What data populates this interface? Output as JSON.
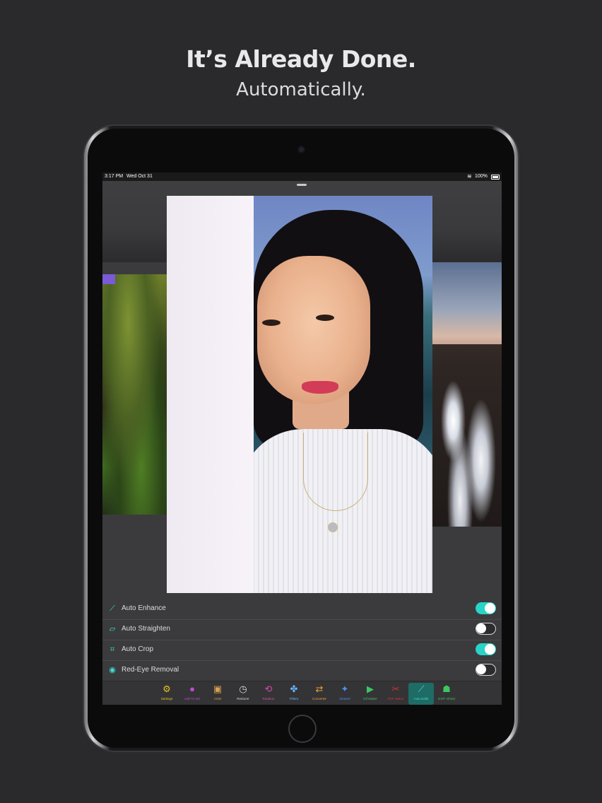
{
  "marketing": {
    "headline": "It’s Already Done.",
    "subline": "Automatically."
  },
  "status_bar": {
    "time": "3:17 PM",
    "date": "Wed Oct 31",
    "battery": "100%"
  },
  "options": [
    {
      "label": "Auto Enhance",
      "icon": "magic-wand-icon",
      "glyph": "⟋",
      "enabled": true
    },
    {
      "label": "Auto Straighten",
      "icon": "straighten-icon",
      "glyph": "▱",
      "enabled": false
    },
    {
      "label": "Auto Crop",
      "icon": "crop-icon",
      "glyph": "⌗",
      "enabled": true
    },
    {
      "label": "Red-Eye Removal",
      "icon": "eye-icon",
      "glyph": "◉",
      "enabled": false
    }
  ],
  "toolbar": [
    {
      "label": "Settings",
      "icon": "gear-icon",
      "glyph": "⚙",
      "color": "#e8c21a"
    },
    {
      "label": "Add To Siri",
      "icon": "siri-icon",
      "glyph": "●",
      "color": "#c04cd8"
    },
    {
      "label": "Artist",
      "icon": "artist-icon",
      "glyph": "▣",
      "color": "#d9a04a"
    },
    {
      "label": "Restorer",
      "icon": "clock-icon",
      "glyph": "◷",
      "color": "#d9d9db"
    },
    {
      "label": "Rotation",
      "icon": "rotate-icon",
      "glyph": "⟲",
      "color": "#d84bb0"
    },
    {
      "label": "Filters",
      "icon": "filters-icon",
      "glyph": "✤",
      "color": "#6ab3ff"
    },
    {
      "label": "Converter",
      "icon": "converter-icon",
      "glyph": "⇄",
      "color": "#f0a030"
    },
    {
      "label": "Cleaner",
      "icon": "cleaner-icon",
      "glyph": "✦",
      "color": "#4f8ef2"
    },
    {
      "label": "Gif Maker",
      "icon": "gif-icon",
      "glyph": "▶",
      "color": "#3cc760"
    },
    {
      "label": "PDF Maker",
      "icon": "pdf-icon",
      "glyph": "✂",
      "color": "#d8302f"
    },
    {
      "label": "Auto Edits",
      "icon": "magic-wand-icon",
      "glyph": "⟋",
      "color": "#3be0d3"
    },
    {
      "label": "EXIF Ghost",
      "icon": "ghost-icon",
      "glyph": "☗",
      "color": "#3cc760"
    }
  ]
}
